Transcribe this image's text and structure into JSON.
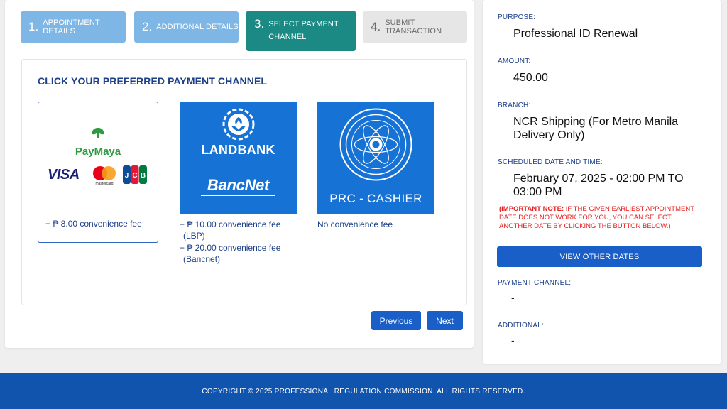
{
  "steps": [
    {
      "num": "1.",
      "label": "APPOINTMENT DETAILS"
    },
    {
      "num": "2.",
      "label": "ADDITIONAL DETAILS"
    },
    {
      "num": "3.",
      "label": "SELECT PAYMENT CHANNEL"
    },
    {
      "num": "4.",
      "label": "SUBMIT TRANSACTION"
    }
  ],
  "panel": {
    "title": "CLICK YOUR PREFERRED PAYMENT CHANNEL",
    "options": {
      "paymaya": {
        "logo_text": "PayMaya",
        "visa_text": "VISA",
        "mc_text": "mastercard",
        "jcb_text": "JCB",
        "fee": "+ ₱ 8.00 convenience fee"
      },
      "landbank": {
        "logo_text": "LANDBANK",
        "bancnet_text": "BancNet",
        "fee1": "+ ₱ 10.00 convenience fee",
        "fee1_sub": "(LBP)",
        "fee2": "+ ₱ 20.00 convenience fee",
        "fee2_sub": "(Bancnet)"
      },
      "prc": {
        "label": "PRC - CASHIER",
        "fee": "No convenience fee"
      }
    }
  },
  "nav": {
    "previous": "Previous",
    "next": "Next"
  },
  "summary": {
    "purpose_label": "PURPOSE:",
    "purpose": "Professional ID Renewal",
    "amount_label": "AMOUNT:",
    "amount": "450.00",
    "branch_label": "BRANCH:",
    "branch": "NCR Shipping (For Metro Manila Delivery Only)",
    "schedule_label": "SCHEDULED DATE AND TIME:",
    "schedule": "February 07, 2025 - 02:00 PM TO 03:00 PM",
    "note_strong": "(IMPORTANT NOTE:",
    "note_rest": " IF THE GIVEN EARLIEST APPOINTMENT DATE DOES NOT WORK FOR YOU, YOU CAN SELECT ANOTHER DATE BY CLICKING THE BUTTON BELOW.)",
    "view_dates": "VIEW OTHER DATES",
    "payment_label": "PAYMENT CHANNEL:",
    "payment": "-",
    "additional_label": "ADDITIONAL:",
    "additional": "-"
  },
  "footer": {
    "text": "COPYRIGHT © 2025 PROFESSIONAL REGULATION COMMISSION. ALL RIGHTS RESERVED."
  },
  "colors": {
    "primary": "#1a5fc8",
    "active_step": "#1b8a84",
    "inactive_step": "#7eb7e6",
    "channel_bg": "#1772d6",
    "note_red": "#e52020",
    "footer": "#1154ae"
  }
}
